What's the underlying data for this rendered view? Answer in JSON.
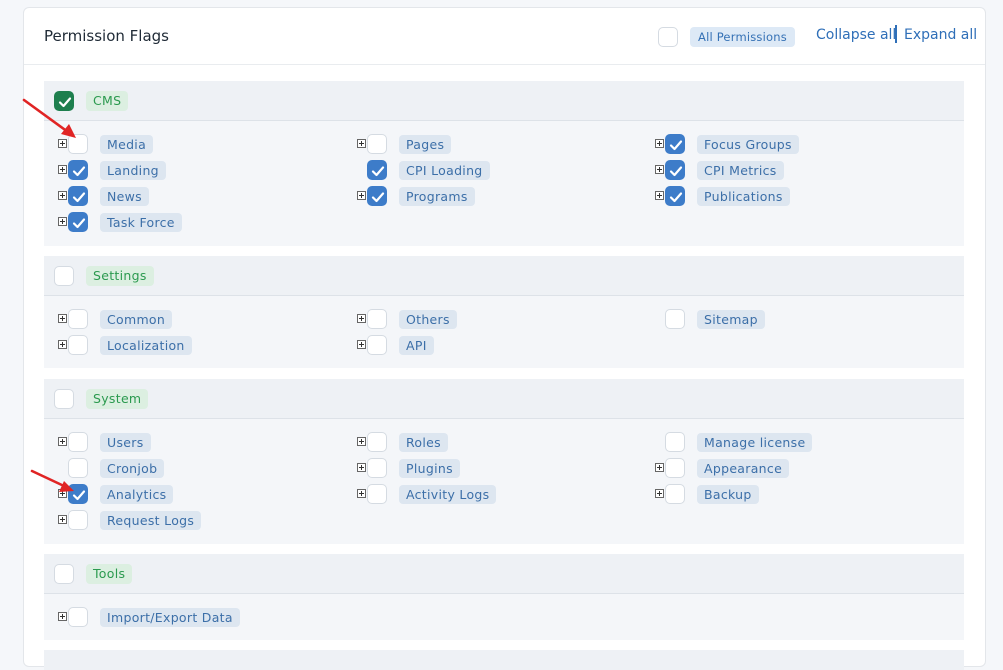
{
  "header": {
    "title": "Permission Flags",
    "all_permissions": "All Permissions",
    "collapse_all": "Collapse all",
    "expand_all": "Expand all"
  },
  "groups": [
    {
      "label": "CMS",
      "checked": true,
      "items": [
        {
          "label": "Media",
          "checked": false,
          "expandable": true
        },
        {
          "label": "Pages",
          "checked": false,
          "expandable": true
        },
        {
          "label": "Focus Groups",
          "checked": true,
          "expandable": true
        },
        {
          "label": "Landing",
          "checked": true,
          "expandable": true
        },
        {
          "label": "CPI Loading",
          "checked": true,
          "expandable": false
        },
        {
          "label": "CPI Metrics",
          "checked": true,
          "expandable": true
        },
        {
          "label": "News",
          "checked": true,
          "expandable": true
        },
        {
          "label": "Programs",
          "checked": true,
          "expandable": true
        },
        {
          "label": "Publications",
          "checked": true,
          "expandable": true
        },
        {
          "label": "Task Force",
          "checked": true,
          "expandable": true
        }
      ]
    },
    {
      "label": "Settings",
      "checked": false,
      "items": [
        {
          "label": "Common",
          "checked": false,
          "expandable": true
        },
        {
          "label": "Others",
          "checked": false,
          "expandable": true
        },
        {
          "label": "Sitemap",
          "checked": false,
          "expandable": false
        },
        {
          "label": "Localization",
          "checked": false,
          "expandable": true
        },
        {
          "label": "API",
          "checked": false,
          "expandable": true
        }
      ]
    },
    {
      "label": "System",
      "checked": false,
      "items": [
        {
          "label": "Users",
          "checked": false,
          "expandable": true
        },
        {
          "label": "Roles",
          "checked": false,
          "expandable": true
        },
        {
          "label": "Manage license",
          "checked": false,
          "expandable": false
        },
        {
          "label": "Cronjob",
          "checked": false,
          "expandable": false
        },
        {
          "label": "Plugins",
          "checked": false,
          "expandable": true
        },
        {
          "label": "Appearance",
          "checked": false,
          "expandable": true
        },
        {
          "label": "Analytics",
          "checked": true,
          "expandable": true
        },
        {
          "label": "Activity Logs",
          "checked": false,
          "expandable": true
        },
        {
          "label": "Backup",
          "checked": false,
          "expandable": true
        },
        {
          "label": "Request Logs",
          "checked": false,
          "expandable": true
        }
      ]
    },
    {
      "label": "Tools",
      "checked": false,
      "items": [
        {
          "label": "Import/Export Data",
          "checked": false,
          "expandable": true
        }
      ]
    }
  ],
  "colors": {
    "accent_blue": "#3d7cc9",
    "accent_green": "#1e7f4e",
    "badge_green_text": "#2b9a4f",
    "badge_blue_text": "#3c6fa8",
    "arrow_red": "#e02424"
  }
}
